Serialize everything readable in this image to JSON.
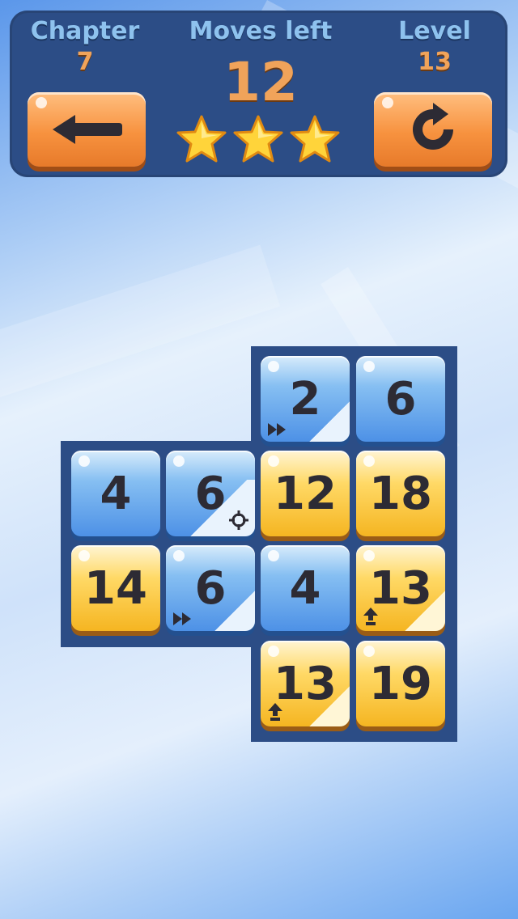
{
  "hud": {
    "chapter_label": "Chapter",
    "chapter_value": "7",
    "moves_label": "Moves left",
    "moves_value": "12",
    "level_label": "Level",
    "level_value": "13",
    "stars_count": 3,
    "back_icon": "left-arrow-icon",
    "restart_icon": "restart-icon"
  },
  "colors": {
    "hud_bg": "#2c4d86",
    "label": "#8ec2ee",
    "value": "#f0a35a",
    "button": "#f7923f",
    "tile_blue": "#4d91e6",
    "tile_gold": "#f5b521",
    "digit": "#2d2b34"
  },
  "board": {
    "rows": [
      [
        null,
        null,
        {
          "value": "2",
          "color": "blue",
          "modifier": "fast-forward"
        },
        {
          "value": "6",
          "color": "blue",
          "modifier": null
        }
      ],
      [
        {
          "value": "4",
          "color": "blue",
          "modifier": null
        },
        {
          "value": "6",
          "color": "blue",
          "modifier": "target"
        },
        {
          "value": "12",
          "color": "gold",
          "modifier": null
        },
        {
          "value": "18",
          "color": "gold",
          "modifier": null
        }
      ],
      [
        {
          "value": "14",
          "color": "gold",
          "modifier": null
        },
        {
          "value": "6",
          "color": "blue",
          "modifier": "fast-forward"
        },
        {
          "value": "4",
          "color": "blue",
          "modifier": null
        },
        {
          "value": "13",
          "color": "gold",
          "modifier": "up-arrow"
        }
      ],
      [
        null,
        null,
        {
          "value": "13",
          "color": "gold",
          "modifier": "up-arrow"
        },
        {
          "value": "19",
          "color": "gold",
          "modifier": null
        }
      ]
    ]
  }
}
